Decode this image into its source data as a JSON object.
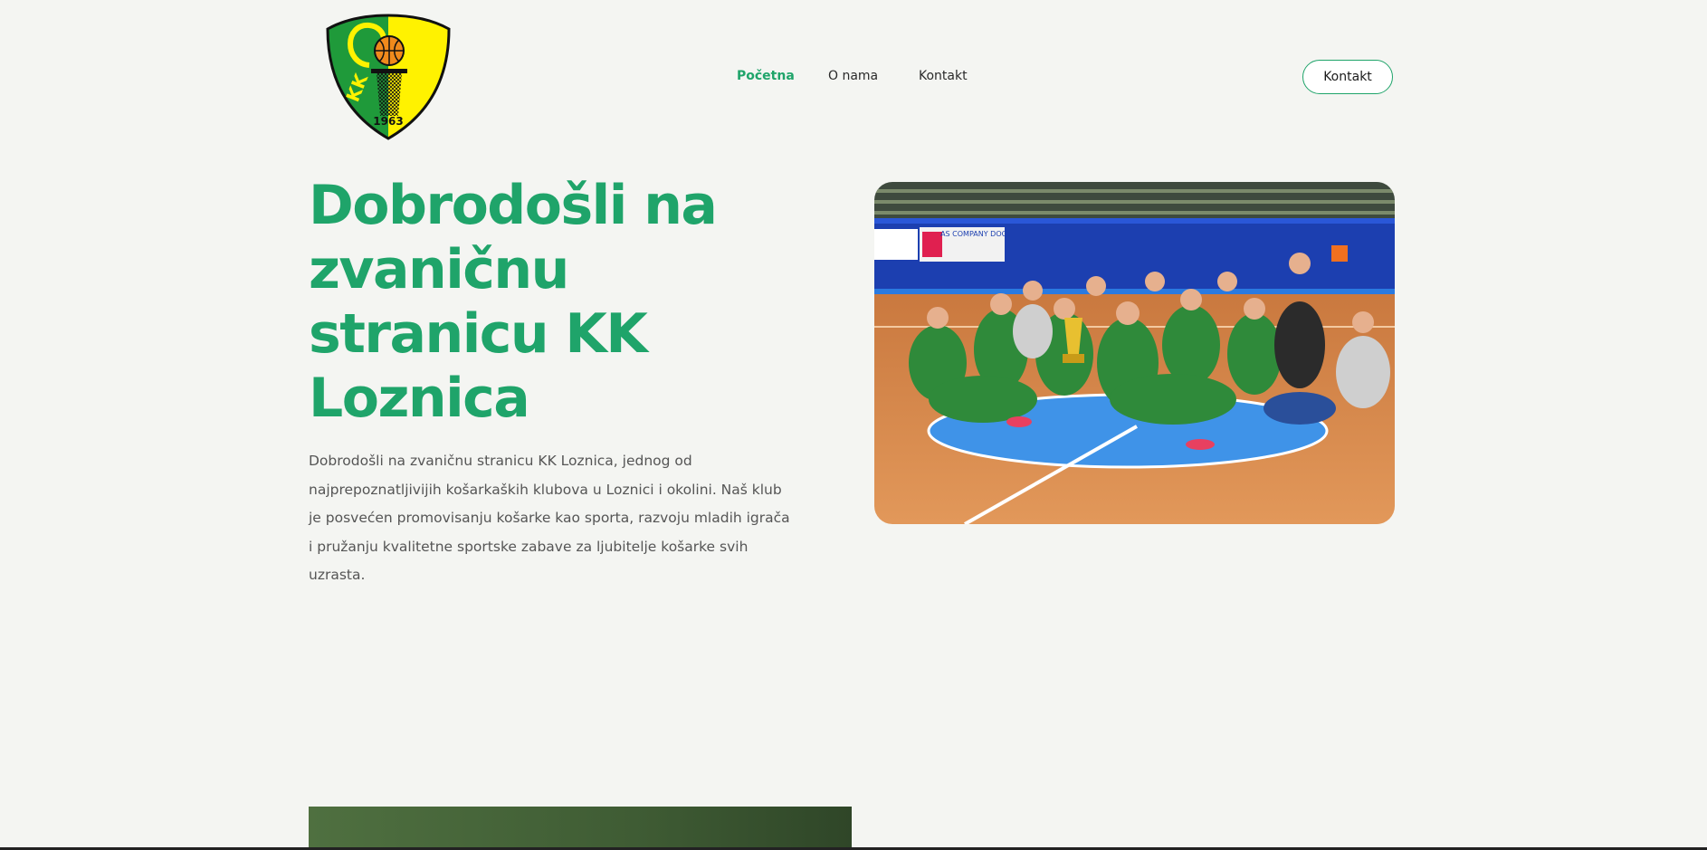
{
  "header": {
    "logo": {
      "year": "1963",
      "letters": "KK",
      "colors": {
        "green": "#1f9a3a",
        "yellow": "#fff200",
        "orange": "#f08a1c"
      }
    },
    "nav": [
      {
        "label": "Početna",
        "active": true
      },
      {
        "label": "O nama",
        "active": false
      },
      {
        "label": "Kontakt",
        "active": false
      }
    ],
    "cta_label": "Kontakt"
  },
  "hero": {
    "title": "Dobrodošli na zvaničnu stranicu KK Loznica",
    "text": "Dobrodošli na zvaničnu stranicu KK Loznica, jednog od najprepoznatljivijih košarkaških klubova u Loznici i okolini. Naš klub je posvećen promovisanju košarke kao sporta, razvoju mladih igrača i pružanju kvalitetne sportske zabave za ljubitelje košarke svih uzrasta."
  },
  "photo": {
    "banner_text": "AS COMPANY DOO"
  },
  "colors": {
    "accent": "#1fa46a",
    "background": "#f4f5f2",
    "text": "#555555"
  }
}
